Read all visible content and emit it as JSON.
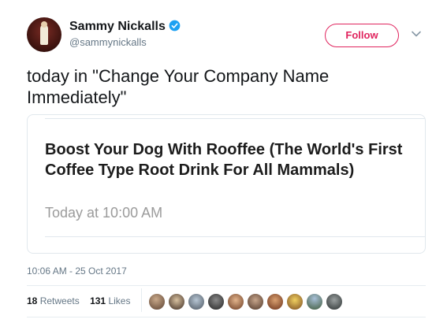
{
  "author": {
    "display_name": "Sammy Nickalls",
    "handle": "@sammynickalls",
    "verified": true
  },
  "follow_button": {
    "label": "Follow"
  },
  "tweet": {
    "text": "today in \"Change Your Company Name Immediately\""
  },
  "card": {
    "title": "Boost Your Dog With Rooffee (The World's First Coffee Type Root Drink For All Mammals)",
    "subtitle": "Today at 10:00 AM"
  },
  "timestamp": "10:06 AM - 25 Oct 2017",
  "stats": {
    "retweets_count": "18",
    "retweets_label": "Retweets",
    "likes_count": "131",
    "likes_label": "Likes"
  },
  "colors": {
    "follow_accent": "#e0245e",
    "verified_blue": "#1da1f2",
    "secondary_text": "#657786"
  },
  "icons": {
    "verified": "verified-badge-icon",
    "chevron": "chevron-down-icon"
  },
  "liker_avatar_count": 10
}
